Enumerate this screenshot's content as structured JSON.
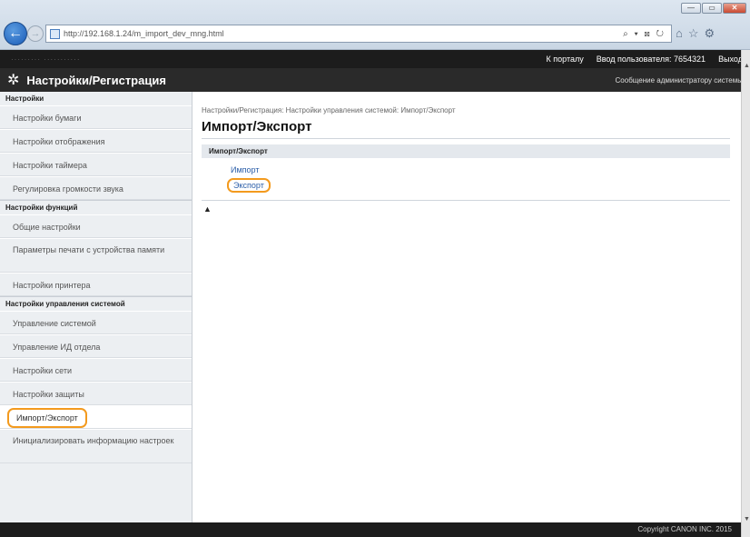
{
  "window": {
    "minimize": "—",
    "maximize": "▭",
    "close": "✕"
  },
  "browser": {
    "address": "http://192.168.1.24/m_import_dev_mng.html",
    "tools": "⌕ ▾ ⊠ ↻",
    "icons": [
      "⌂",
      "☆",
      "⚙"
    ]
  },
  "topbar": {
    "left_blur": "·········   ···········",
    "portal_link": "К порталу",
    "login_label": "Ввод пользователя:",
    "user_id": "7654321",
    "logout": "Выход"
  },
  "titlebar": {
    "title": "Настройки/Регистрация",
    "admin_msg": "Сообщение администратору системы"
  },
  "sidebar": {
    "sections": [
      {
        "heading": "Настройки",
        "items": [
          "Настройки бумаги",
          "Настройки отображения",
          "Настройки таймера",
          "Регулировка громкости звука"
        ]
      },
      {
        "heading": "Настройки функций",
        "items": [
          "Общие настройки",
          "Параметры печати с устройства памяти",
          "Настройки принтера"
        ]
      },
      {
        "heading": "Настройки управления системой",
        "items": [
          "Управление системой",
          "Управление ИД отдела",
          "Настройки сети",
          "Настройки защиты",
          "Импорт/Экспорт",
          "Инициализировать информацию настроек"
        ]
      }
    ]
  },
  "main": {
    "breadcrumb": "Настройки/Регистрация: Настройки управления системой: Импорт/Экспорт",
    "title": "Импорт/Экспорт",
    "panel_heading": "Импорт/Экспорт",
    "links": {
      "import": "Импорт",
      "export": "Экспорт"
    },
    "top_arrow": "▲"
  },
  "footer": {
    "copyright": "Copyright CANON INC. 2015"
  },
  "colors": {
    "highlight": "#f39a1e",
    "link": "#2a5da8",
    "header_bg": "#2a2a2a"
  }
}
